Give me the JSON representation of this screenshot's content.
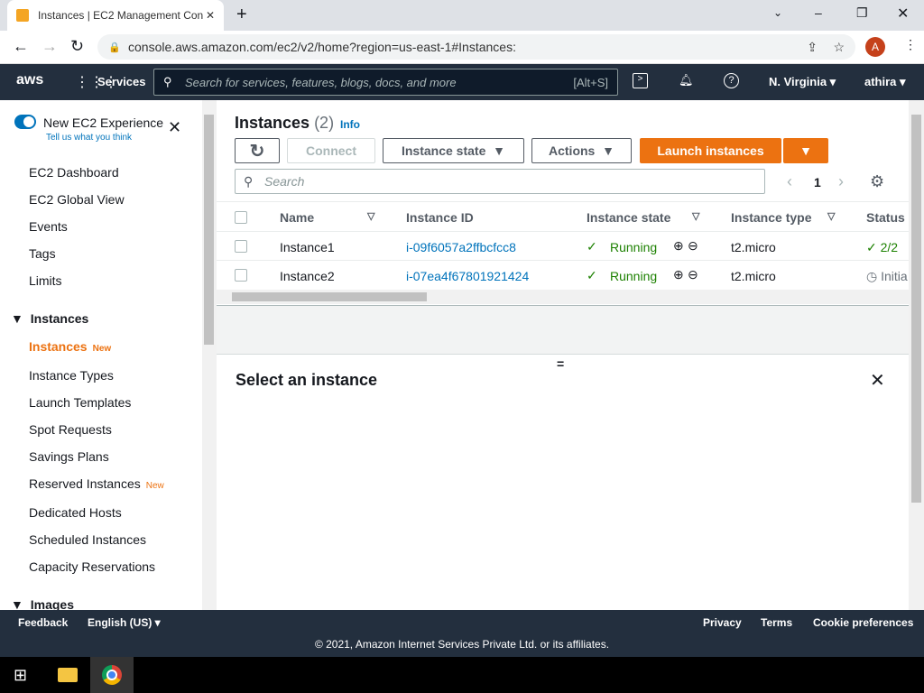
{
  "browser": {
    "tab_title": "Instances | EC2 Management Con",
    "url": "console.aws.amazon.com/ec2/v2/home?region=us-east-1#Instances:",
    "profile_initial": "A"
  },
  "awsnav": {
    "services": "Services",
    "search_placeholder": "Search for services, features, blogs, docs, and more",
    "shortcut": "[Alt+S]",
    "region": "N. Virginia",
    "user": "athira"
  },
  "sidebar": {
    "toggle_label": "New EC2 Experience",
    "feedback": "Tell us what you think",
    "items": [
      "EC2 Dashboard",
      "EC2 Global View",
      "Events",
      "Tags",
      "Limits"
    ],
    "section_instances": "Instances",
    "instances_items": [
      {
        "label": "Instances",
        "badge": "New"
      },
      {
        "label": "Instance Types"
      },
      {
        "label": "Launch Templates"
      },
      {
        "label": "Spot Requests"
      },
      {
        "label": "Savings Plans"
      },
      {
        "label": "Reserved Instances",
        "badge": "New"
      },
      {
        "label": "Dedicated Hosts"
      },
      {
        "label": "Scheduled Instances"
      },
      {
        "label": "Capacity Reservations"
      }
    ],
    "section_images": "Images"
  },
  "main": {
    "title": "Instances",
    "count": "(2)",
    "info": "Info",
    "connect": "Connect",
    "instance_state": "Instance state",
    "actions": "Actions",
    "launch": "Launch instances",
    "search_placeholder": "Search",
    "page": "1",
    "columns": [
      "Name",
      "Instance ID",
      "Instance state",
      "Instance type",
      "Status"
    ],
    "rows": [
      {
        "name": "Instance1",
        "id": "i-09f6057a2ffbcfcc8",
        "state": "Running",
        "type": "t2.micro",
        "status": "2/2"
      },
      {
        "name": "Instance2",
        "id": "i-07ea4f67801921424",
        "state": "Running",
        "type": "t2.micro",
        "status": "Initia"
      }
    ],
    "detail_title": "Select an instance"
  },
  "footer": {
    "feedback": "Feedback",
    "language": "English (US)",
    "privacy": "Privacy",
    "terms": "Terms",
    "cookies": "Cookie preferences",
    "copyright": "© 2021, Amazon Internet Services Private Ltd. or its affiliates."
  }
}
